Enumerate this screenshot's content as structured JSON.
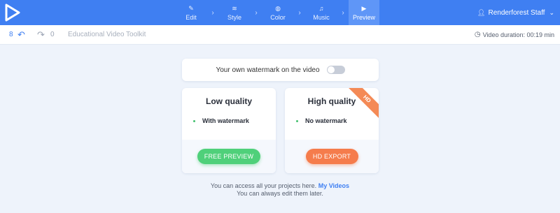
{
  "header": {
    "steps": [
      {
        "label": "Edit",
        "icon": "pencil-icon",
        "glyph": "✎"
      },
      {
        "label": "Style",
        "icon": "layers-icon",
        "glyph": "≋"
      },
      {
        "label": "Color",
        "icon": "palette-icon",
        "glyph": "◍"
      },
      {
        "label": "Music",
        "icon": "music-note-icon",
        "glyph": "♫"
      },
      {
        "label": "Preview",
        "icon": "play-icon",
        "glyph": "▶"
      }
    ],
    "active_step": "Preview",
    "user_name": "Renderforest Staff",
    "accent_color": "#3f7ff2"
  },
  "toolbar": {
    "undo_count": "8",
    "redo_count": "0",
    "project_title": "Educational Video Toolkit",
    "duration": "Video duration: 00:19 min"
  },
  "watermark": {
    "label": "Your own watermark on the video",
    "enabled": false
  },
  "plans": {
    "low": {
      "title": "Low quality",
      "feature": "With watermark",
      "button": "FREE PREVIEW",
      "color": "#4fd07a"
    },
    "high": {
      "title": "High quality",
      "feature": "No watermark",
      "button": "HD EXPORT",
      "badge": "HD",
      "color": "#f57c4c"
    }
  },
  "footer": {
    "line1": "You can access all your projects here.",
    "link": "My Videos",
    "line2": "You can always edit them later."
  }
}
